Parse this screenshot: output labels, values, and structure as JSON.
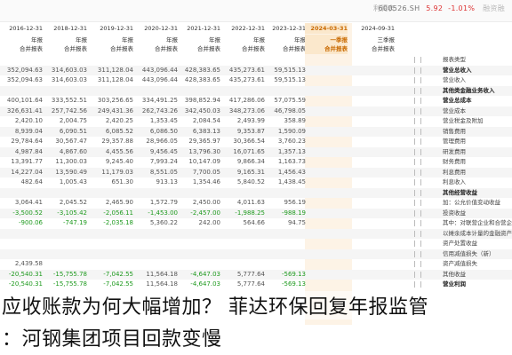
{
  "topbar": {
    "menu": "利润表",
    "code": "600526.SH",
    "price": "5.92",
    "change": "-1.01%",
    "flag": "融资融"
  },
  "periods": [
    {
      "date": "2016-12-31",
      "type": "年报",
      "basis": "合并报表"
    },
    {
      "date": "2018-12-31",
      "type": "年报",
      "basis": "合并报表"
    },
    {
      "date": "2019-12-31",
      "type": "年报",
      "basis": "合并报表"
    },
    {
      "date": "2020-12-31",
      "type": "年报",
      "basis": "合并报表"
    },
    {
      "date": "2021-12-31",
      "type": "年报",
      "basis": "合并报表"
    },
    {
      "date": "2022-12-31",
      "type": "年报",
      "basis": "合并报表"
    },
    {
      "date": "2023-12-31",
      "type": "年报",
      "basis": "合并报表"
    },
    {
      "date": "2024-03-31",
      "type": "一季报",
      "basis": "合并报表"
    },
    {
      "date": "2024-09-31",
      "type": "三季报",
      "basis": "合并报表"
    }
  ],
  "rows": [
    {
      "label": "报表类型",
      "bold": false,
      "values": [
        "",
        "",
        "",
        "",
        "",
        "",
        "",
        "",
        ""
      ]
    },
    {
      "label": "营业总收入",
      "bold": true,
      "values": [
        "352,094.63",
        "314,603.03",
        "311,128.04",
        "443,096.44",
        "428,383.65",
        "435,273.61",
        "59,515.13",
        "",
        ""
      ]
    },
    {
      "label": "营业收入",
      "bold": false,
      "values": [
        "352,094.63",
        "314,603.03",
        "311,128.04",
        "443,096.44",
        "428,383.65",
        "435,273.61",
        "59,515.13",
        "",
        ""
      ]
    },
    {
      "label": "其他类金融业务收入",
      "bold": true,
      "values": [
        "",
        "",
        "",
        "",
        "",
        "",
        "",
        "",
        ""
      ]
    },
    {
      "label": "营业总成本",
      "bold": true,
      "values": [
        "400,101.64",
        "333,552.51",
        "303,256.65",
        "334,491.25",
        "398,852.94",
        "417,286.06",
        "57,075.59",
        "",
        ""
      ]
    },
    {
      "label": "营业成本",
      "bold": false,
      "values": [
        "326,631.41",
        "257,742.56",
        "249,431.36",
        "262,743.26",
        "342,450.03",
        "348,273.06",
        "46,798.05",
        "",
        ""
      ]
    },
    {
      "label": "营业税金及附加",
      "bold": false,
      "values": [
        "2,420.10",
        "2,004.75",
        "2,420.25",
        "1,353.45",
        "2,084.54",
        "2,493.99",
        "358.89",
        "",
        ""
      ]
    },
    {
      "label": "销售费用",
      "bold": false,
      "values": [
        "8,939.04",
        "6,090.51",
        "6,085.52",
        "6,086.50",
        "6,383.13",
        "9,353.87",
        "1,590.09",
        "",
        ""
      ]
    },
    {
      "label": "管理费用",
      "bold": false,
      "values": [
        "29,784.64",
        "30,567.47",
        "29,357.88",
        "28,966.05",
        "29,365.97",
        "30,366.54",
        "3,760.23",
        "",
        ""
      ]
    },
    {
      "label": "研发费用",
      "bold": false,
      "values": [
        "4,987.84",
        "4,867.60",
        "4,455.56",
        "9,456.45",
        "13,796.30",
        "16,071.65",
        "1,357.13",
        "",
        ""
      ]
    },
    {
      "label": "财务费用",
      "bold": false,
      "values": [
        "13,391.77",
        "11,300.03",
        "9,245.40",
        "7,993.24",
        "10,147.09",
        "9,866.34",
        "1,163.73",
        "",
        ""
      ]
    },
    {
      "label": "利息费用",
      "bold": false,
      "values": [
        "14,227.04",
        "13,590.49",
        "11,179.03",
        "8,551.05",
        "7,700.05",
        "9,165.31",
        "1,456.43",
        "",
        ""
      ]
    },
    {
      "label": "利息收入",
      "bold": false,
      "values": [
        "482.64",
        "1,005.43",
        "651.30",
        "913.13",
        "1,354.46",
        "5,840.52",
        "1,438.45",
        "",
        ""
      ]
    },
    {
      "label": "其他经营收益",
      "bold": true,
      "values": [
        "",
        "",
        "",
        "",
        "",
        "",
        "",
        "",
        ""
      ]
    },
    {
      "label": "加：公允价值变动收益",
      "bold": false,
      "values": [
        "3,064.41",
        "2,045.52",
        "2,465.90",
        "1,572.79",
        "2,450.00",
        "4,011.63",
        "956.19",
        "",
        ""
      ]
    },
    {
      "label": "投资收益",
      "bold": false,
      "values": [
        "-3,500.52",
        "-3,105.42",
        "-2,056.11",
        "-1,453.00",
        "-2,457.00",
        "-1,988.25",
        "-988.19",
        "",
        ""
      ]
    },
    {
      "label": "其中：对联营企业和合营企业的投资收益",
      "bold": false,
      "values": [
        "-900.06",
        "-747.19",
        "-2,035.18",
        "5,360.22",
        "242.00",
        "564.66",
        "94.75",
        "",
        ""
      ]
    },
    {
      "label": "以摊余成本计量的金融资产终止确认收益",
      "bold": false,
      "values": [
        "",
        "",
        "",
        "",
        "",
        "",
        "",
        "",
        ""
      ]
    },
    {
      "label": "资产处置收益",
      "bold": false,
      "values": [
        "",
        "",
        "",
        "",
        "",
        "",
        "",
        "",
        ""
      ]
    },
    {
      "label": "信用减值损失（新）",
      "bold": false,
      "values": [
        "",
        "",
        "",
        "",
        "",
        "",
        "",
        "",
        ""
      ]
    },
    {
      "label": "资产减值损失",
      "bold": false,
      "values": [
        "2,439.58",
        "",
        "",
        "",
        "",
        "",
        "",
        "",
        ""
      ]
    },
    {
      "label": "其他收益",
      "bold": false,
      "values": [
        "-20,540.31",
        "-15,755.78",
        "-7,042.55",
        "11,564.18",
        "-4,647.03",
        "5,777.64",
        "-569.13",
        "",
        ""
      ]
    },
    {
      "label": "营业利润",
      "bold": true,
      "values": [
        "-20,540.31",
        "-15,755.78",
        "-7,042.55",
        "11,564.18",
        "-4,647.03",
        "5,777.64",
        "-569.13",
        "",
        ""
      ]
    }
  ],
  "caption": {
    "line1": "应收账款为何大幅增加？ 菲达环保回复年报监管",
    "line2": "：河钢集团项目回款变慢"
  }
}
